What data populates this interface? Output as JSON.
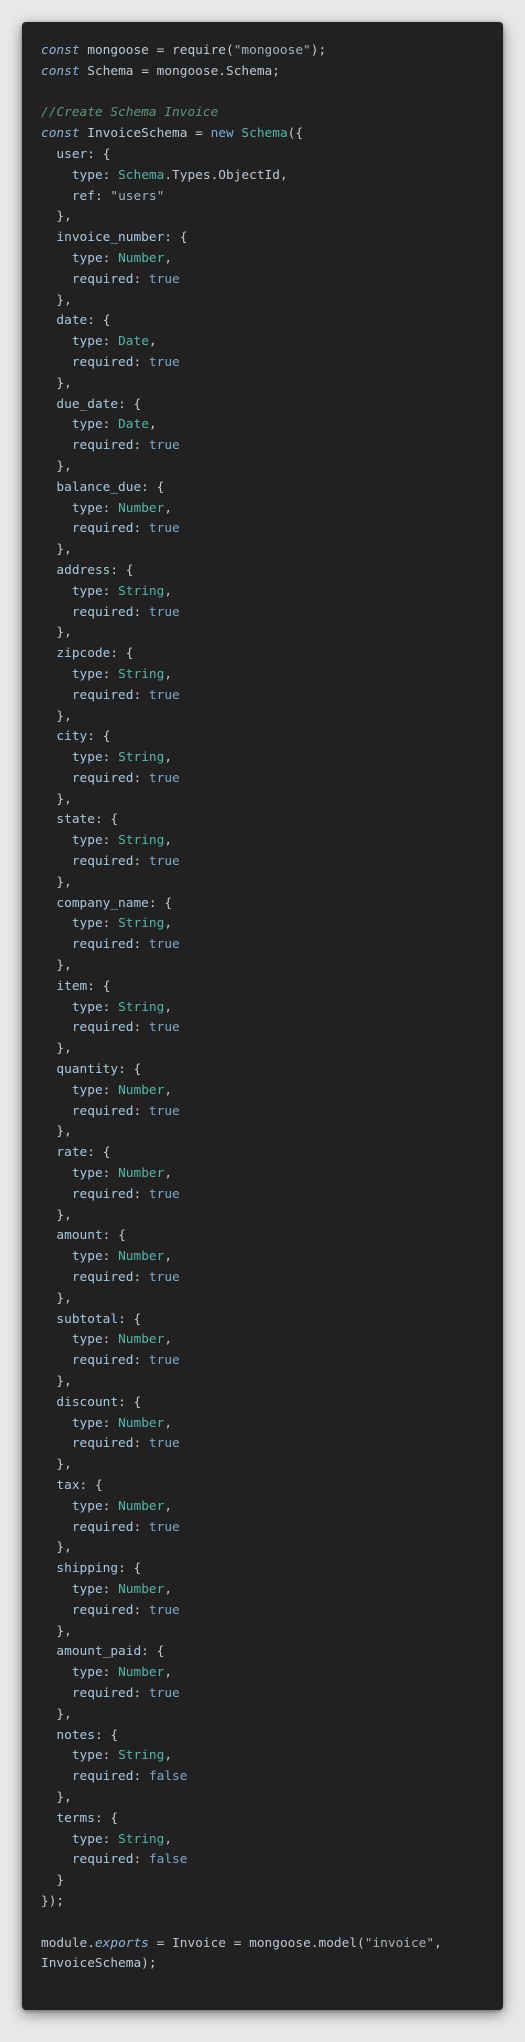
{
  "colors": {
    "page_background": "#e8e8e8",
    "editor_background": "#212121",
    "keyword": "#8ab4d8",
    "type_name": "#4fb8a8",
    "boolean": "#7ca9c7",
    "comment": "#5a9a78",
    "string": "#a6b3bd",
    "plain": "#c4cad2"
  },
  "code": {
    "language": "javascript",
    "lines": [
      "const mongoose = require(\"mongoose\");",
      "const Schema = mongoose.Schema;",
      "",
      "//Create Schema Invoice",
      "const InvoiceSchema = new Schema({",
      "  user: {",
      "    type: Schema.Types.ObjectId,",
      "    ref: \"users\"",
      "  },",
      "  invoice_number: {",
      "    type: Number,",
      "    required: true",
      "  },",
      "  date: {",
      "    type: Date,",
      "    required: true",
      "  },",
      "  due_date: {",
      "    type: Date,",
      "    required: true",
      "  },",
      "  balance_due: {",
      "    type: Number,",
      "    required: true",
      "  },",
      "  address: {",
      "    type: String,",
      "    required: true",
      "  },",
      "  zipcode: {",
      "    type: String,",
      "    required: true",
      "  },",
      "  city: {",
      "    type: String,",
      "    required: true",
      "  },",
      "  state: {",
      "    type: String,",
      "    required: true",
      "  },",
      "  company_name: {",
      "    type: String,",
      "    required: true",
      "  },",
      "  item: {",
      "    type: String,",
      "    required: true",
      "  },",
      "  quantity: {",
      "    type: Number,",
      "    required: true",
      "  },",
      "  rate: {",
      "    type: Number,",
      "    required: true",
      "  },",
      "  amount: {",
      "    type: Number,",
      "    required: true",
      "  },",
      "  subtotal: {",
      "    type: Number,",
      "    required: true",
      "  },",
      "  discount: {",
      "    type: Number,",
      "    required: true",
      "  },",
      "  tax: {",
      "    type: Number,",
      "    required: true",
      "  },",
      "  shipping: {",
      "    type: Number,",
      "    required: true",
      "  },",
      "  amount_paid: {",
      "    type: Number,",
      "    required: true",
      "  },",
      "  notes: {",
      "    type: String,",
      "    required: false",
      "  },",
      "  terms: {",
      "    type: String,",
      "    required: false",
      "  }",
      "});",
      "",
      "module.exports = Invoice = mongoose.model(\"invoice\",",
      "InvoiceSchema);"
    ]
  }
}
